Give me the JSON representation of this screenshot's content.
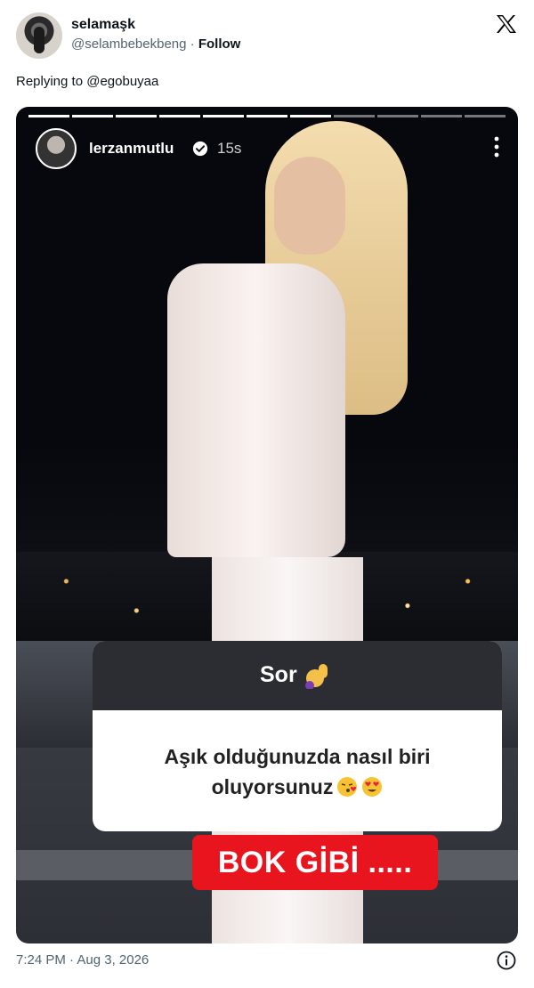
{
  "tweet": {
    "display_name": "selamaşk",
    "handle": "@selambebekbeng",
    "separator": " · ",
    "follow_label": "Follow",
    "replying_prefix": "Replying to ",
    "replying_to": "@egobuyaa",
    "timestamp": "7:24 PM · Aug 3, 2026"
  },
  "story": {
    "username": "lerzanmutlu",
    "time_ago": "15s",
    "progress_segments": 11,
    "progress_done": 7,
    "question_sticker_title": "Sor",
    "question_text": "Aşık olduğunuzda nasıl biri oluyorsunuz",
    "answer_text": "BOK GİBİ .....",
    "answer_color": "#e8141e"
  },
  "icons": [
    "x-logo-icon",
    "verified-icon",
    "more-vertical-icon",
    "raised-hand-icon",
    "kiss-face-icon",
    "heart-eyes-icon",
    "info-icon"
  ]
}
